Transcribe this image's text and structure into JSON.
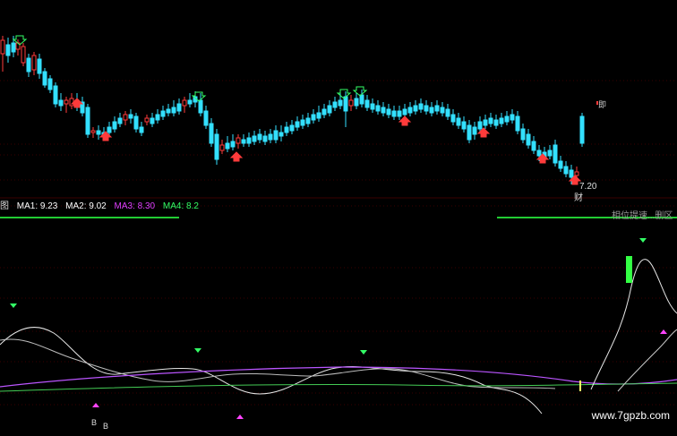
{
  "indicator_bar": {
    "prefix": "图",
    "ma1": "MA1: 9.23",
    "ma2": "MA2: 9.02",
    "ma3": "MA3: 8.30",
    "ma4": "MA4: 8.2"
  },
  "price_label": "7.20",
  "finance_mark": "财",
  "top_right_badge": "即",
  "right_panel_text": "相位提速...删区",
  "bottom_markers": [
    "B",
    "B"
  ],
  "watermark": "www.7gpzb.com",
  "colors": {
    "up": "#ff3b3b",
    "down": "#33e0ff",
    "ma1": "#ffffff",
    "ma2": "#ffff66",
    "ma3": "#e040ff",
    "ma4": "#33ff66",
    "osc_main": "#e6e6e6",
    "osc_slow": "#bb55ff",
    "osc_base": "#44cc55",
    "tri_down": "#33ff66",
    "tri_up": "#ff44ff"
  }
}
